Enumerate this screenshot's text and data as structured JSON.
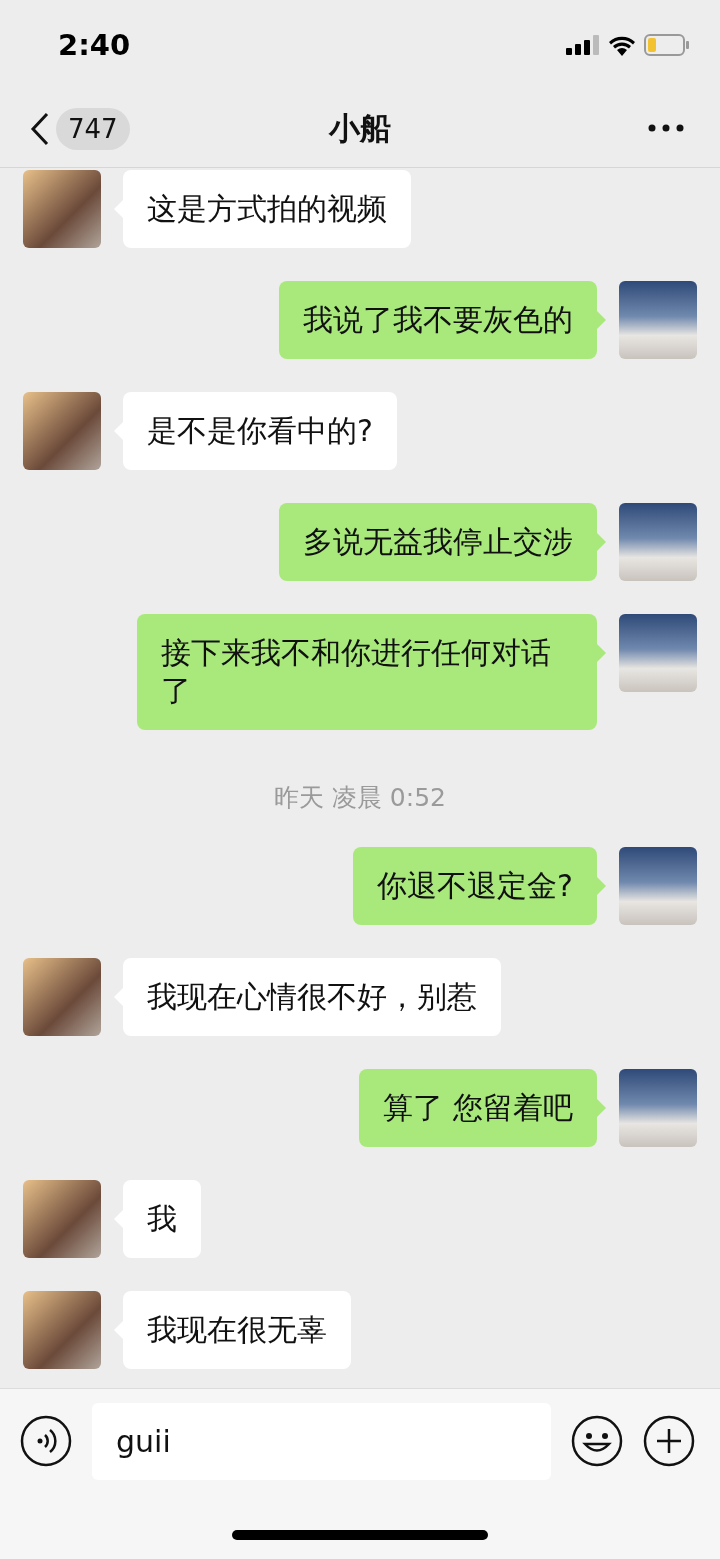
{
  "status_bar": {
    "time": "2:40"
  },
  "nav": {
    "back_count": "747",
    "title": "小船"
  },
  "messages": [
    {
      "kind": "left",
      "text": "这是方式拍的视频"
    },
    {
      "kind": "right",
      "text": "我说了我不要灰色的"
    },
    {
      "kind": "left",
      "text": "是不是你看中的?"
    },
    {
      "kind": "right",
      "text": "多说无益我停止交涉"
    },
    {
      "kind": "right",
      "text": "接下来我不和你进行任何对话了"
    },
    {
      "kind": "time",
      "text": "昨天 凌晨 0:52"
    },
    {
      "kind": "right",
      "text": "你退不退定金?"
    },
    {
      "kind": "left",
      "text": "我现在心情很不好，别惹"
    },
    {
      "kind": "right",
      "text": "算了 您留着吧"
    },
    {
      "kind": "left",
      "text": "我"
    },
    {
      "kind": "left",
      "text": "我现在很无辜"
    }
  ],
  "input": {
    "value": "guii"
  }
}
